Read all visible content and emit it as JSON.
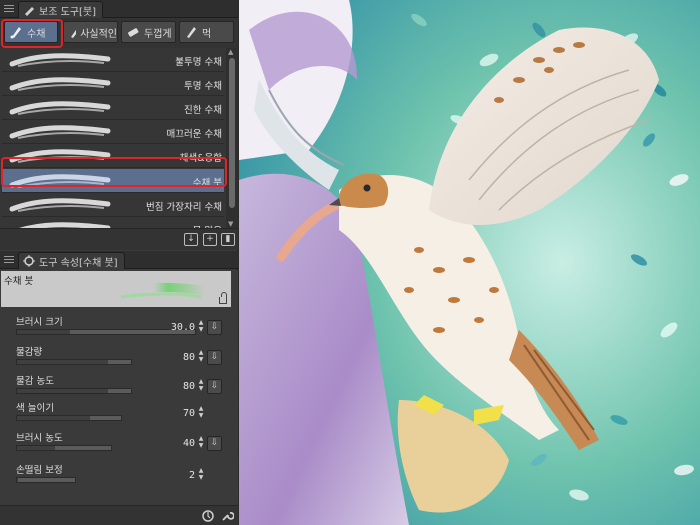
{
  "subtool_panel": {
    "tab_label": "보조 도구[붓]",
    "buttons": [
      "수채",
      "사실적인",
      "두껍게",
      "먹"
    ],
    "brushes": [
      {
        "name": "불투명 수채"
      },
      {
        "name": "투명 수채"
      },
      {
        "name": "진한 수채"
      },
      {
        "name": "매끄러운 수채"
      },
      {
        "name": "채색&융합"
      },
      {
        "name": "수채 붓"
      },
      {
        "name": "번짐 가장자리 수채"
      },
      {
        "name": "물 많음"
      }
    ],
    "selected_index": 5
  },
  "property_panel": {
    "tab_label": "도구 속성[수채 붓]",
    "preview_name": "수채 붓",
    "properties": [
      {
        "label": "브러시 크기",
        "value": "30.0",
        "level": 0.3
      },
      {
        "label": "물감량",
        "value": "80",
        "level": 0.8
      },
      {
        "label": "물감 농도",
        "value": "80",
        "level": 0.8
      },
      {
        "label": "색 늘이기",
        "value": "70",
        "level": 0.7
      },
      {
        "label": "브러시 농도",
        "value": "40",
        "level": 0.4
      },
      {
        "label": "손떨림 보정",
        "value": "2",
        "level": 0.02
      }
    ]
  },
  "colors": {
    "highlight": "#e0242a",
    "selection": "#5d6f8e",
    "panel": "#3a3a3a"
  }
}
